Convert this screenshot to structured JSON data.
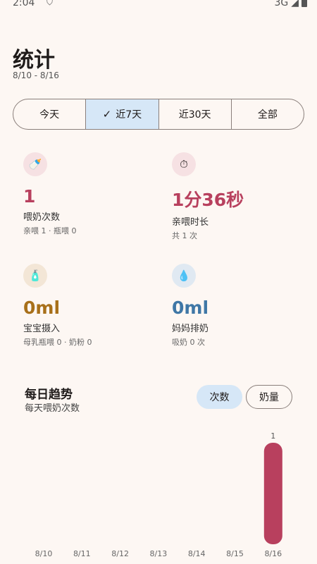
{
  "status_bar": {
    "time": "2:04",
    "network": "3G"
  },
  "header": {
    "title": "统计",
    "date_range": "8/10 - 8/16"
  },
  "range_tabs": [
    {
      "label": "今天",
      "selected": false
    },
    {
      "label": "近7天",
      "selected": true
    },
    {
      "label": "近30天",
      "selected": false
    },
    {
      "label": "全部",
      "selected": false
    }
  ],
  "stats": {
    "feedings": {
      "icon": "bottle-icon",
      "value": "1",
      "label": "喂奶次数",
      "sub": "亲喂 1 · 瓶喂 0",
      "color": "#B8405E"
    },
    "nursing": {
      "icon": "timer-icon",
      "value": "1分36秒",
      "label": "亲喂时长",
      "sub": "共 1 次",
      "color": "#B8405E"
    },
    "baby_intake": {
      "icon": "formula-icon",
      "value": "0ml",
      "label": "宝宝摄入",
      "sub": "母乳瓶喂 0 · 奶粉 0",
      "color": "#A8701A"
    },
    "pumping": {
      "icon": "drop-icon",
      "value": "0ml",
      "label": "妈妈排奶",
      "sub": "吸奶 0 次",
      "color": "#3F77A6"
    }
  },
  "trend": {
    "title": "每日趋势",
    "subtitle": "每天喂奶次数",
    "chips": {
      "count": "次数",
      "volume": "奶量"
    }
  },
  "chart_data": {
    "type": "bar",
    "categories": [
      "8/10",
      "8/11",
      "8/12",
      "8/13",
      "8/14",
      "8/15",
      "8/16"
    ],
    "values": [
      0,
      0,
      0,
      0,
      0,
      0,
      1
    ],
    "data_labels": [
      "",
      "",
      "",
      "",
      "",
      "",
      "1"
    ],
    "ylim": [
      0,
      1
    ],
    "bar_color": "#B8405E",
    "grid": false
  }
}
